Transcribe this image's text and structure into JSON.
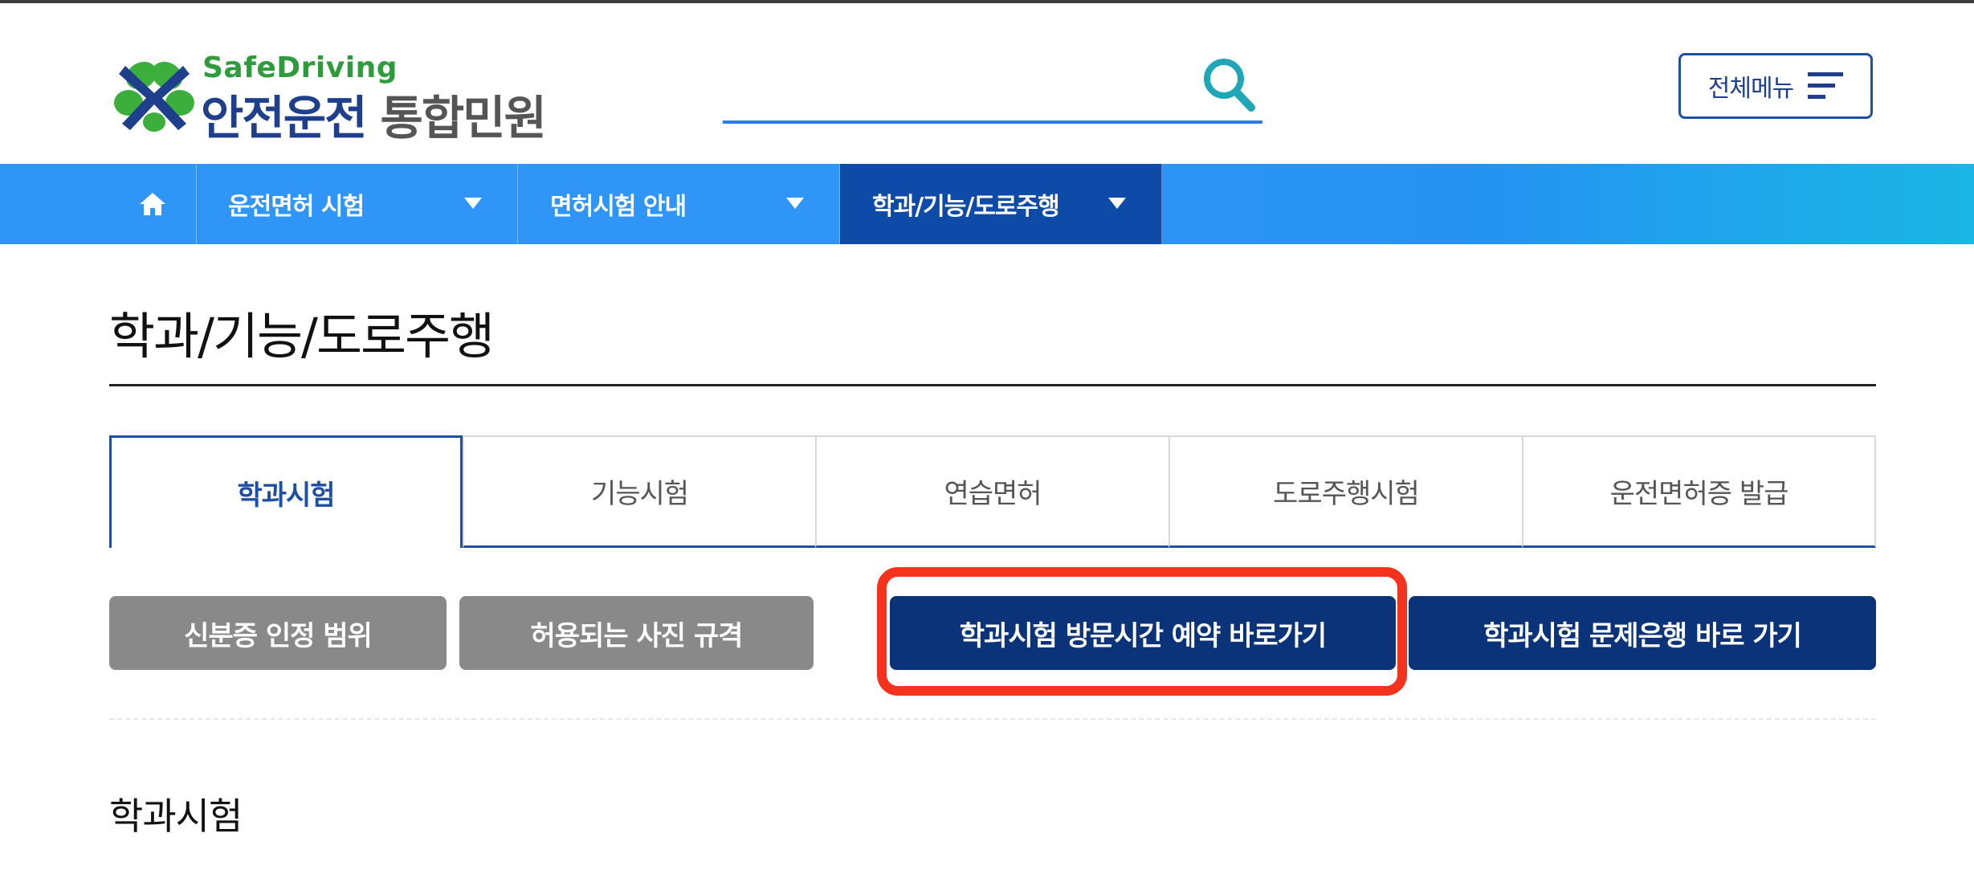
{
  "header": {
    "logo_en": "SafeDriving",
    "logo_main": "안전운전",
    "logo_sub": "통합민원",
    "search_value": "",
    "all_menu_label": "전체메뉴"
  },
  "nav": {
    "items": [
      {
        "label": "운전면허 시험"
      },
      {
        "label": "면허시험 안내"
      },
      {
        "label": "학과/기능/도로주행"
      }
    ]
  },
  "page": {
    "title": "학과/기능/도로주행",
    "section_title": "학과시험"
  },
  "tabs": [
    {
      "label": "학과시험",
      "active": true
    },
    {
      "label": "기능시험"
    },
    {
      "label": "연습면허"
    },
    {
      "label": "도로주행시험"
    },
    {
      "label": "운전면허증 발급"
    }
  ],
  "buttons": [
    {
      "label": "신분증 인정 범위",
      "style": "gray"
    },
    {
      "label": "허용되는 사진 규격",
      "style": "gray"
    },
    {
      "label": "학과시험 방문시간 예약 바로가기",
      "style": "navy",
      "highlighted": true
    },
    {
      "label": "학과시험 문제은행 바로 가기",
      "style": "navy"
    }
  ],
  "colors": {
    "nav_blue": "#2f95f6",
    "nav_active": "#0e4aa8",
    "brand_navy": "#1d3f8c",
    "button_navy": "#0b337a",
    "button_gray": "#898989",
    "highlight_red": "#f4321e",
    "logo_green": "#2e9c3c"
  },
  "icons": {
    "logo": "clover-logo-icon",
    "search": "search-icon",
    "menu": "hamburger-menu-icon",
    "home": "home-icon",
    "caret": "caret-down-icon"
  }
}
